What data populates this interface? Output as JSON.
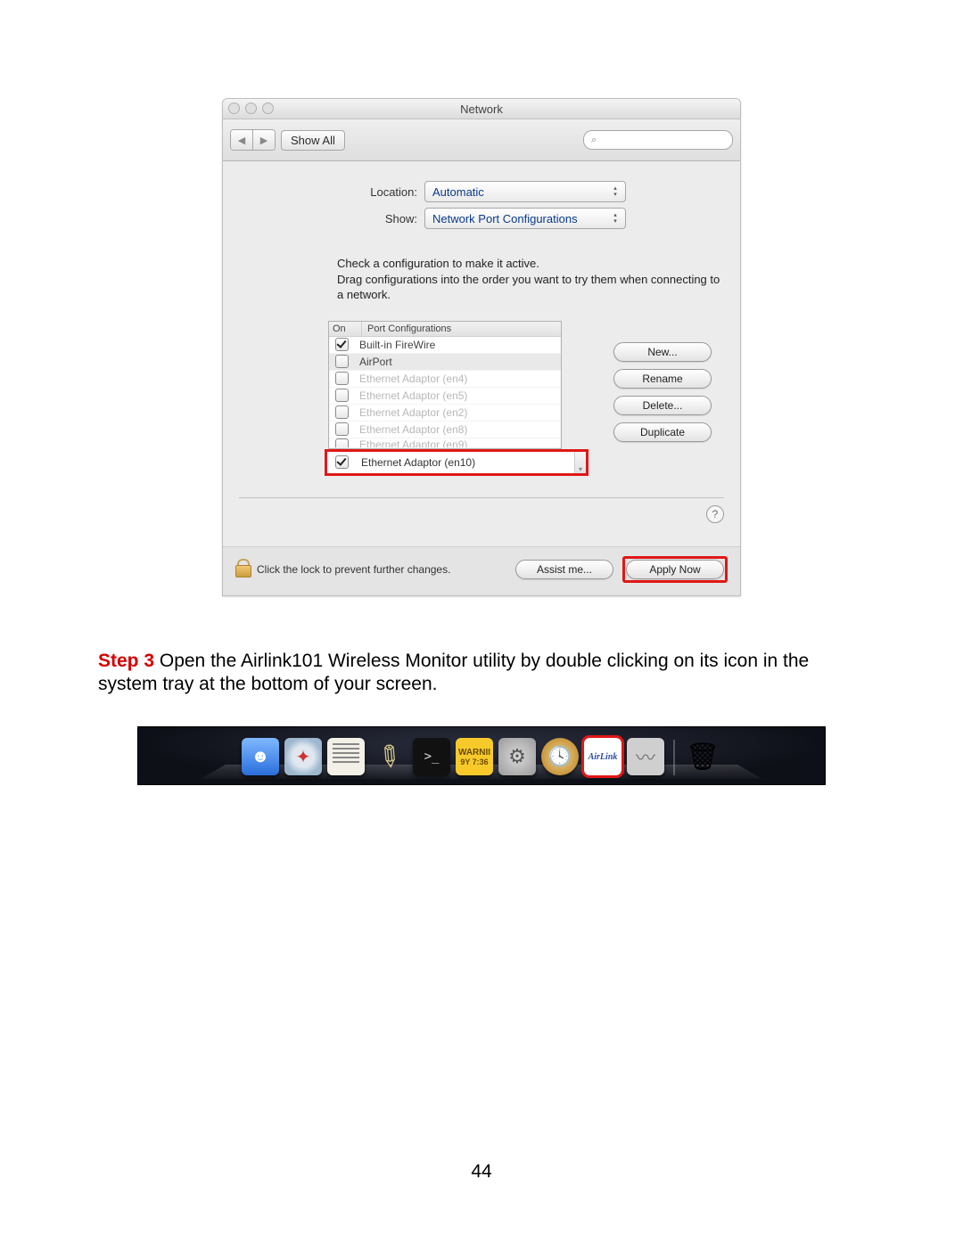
{
  "page_number": "44",
  "step": {
    "label": "Step 3",
    "text": " Open the Airlink101 Wireless Monitor utility by double clicking on its icon in the system tray at the bottom of your screen."
  },
  "network_window": {
    "title": "Network",
    "toolbar": {
      "show_all": "Show All",
      "search_placeholder": ""
    },
    "form": {
      "location_label": "Location:",
      "location_value": "Automatic",
      "show_label": "Show:",
      "show_value": "Network Port Configurations"
    },
    "instructions": "Check a configuration to make it active.\nDrag configurations into the order you want to try them when connecting to a network.",
    "port_header": {
      "on": "On",
      "name": "Port Configurations"
    },
    "ports": [
      {
        "checked": true,
        "name": "Built-in FireWire",
        "selected": false,
        "faded": false
      },
      {
        "checked": false,
        "name": "AirPort",
        "selected": true,
        "faded": false
      },
      {
        "checked": false,
        "name": "Ethernet Adaptor (en4)",
        "selected": false,
        "faded": true
      },
      {
        "checked": false,
        "name": "Ethernet Adaptor (en5)",
        "selected": false,
        "faded": true
      },
      {
        "checked": false,
        "name": "Ethernet Adaptor (en2)",
        "selected": false,
        "faded": true
      },
      {
        "checked": false,
        "name": "Ethernet Adaptor (en8)",
        "selected": false,
        "faded": true
      },
      {
        "checked": false,
        "name": "Ethernet Adaptor (en9)",
        "selected": false,
        "faded": true,
        "cutoff": true
      }
    ],
    "highlight_port": {
      "checked": true,
      "name": "Ethernet Adaptor (en10)"
    },
    "side_buttons": {
      "new": "New...",
      "rename": "Rename",
      "delete": "Delete...",
      "duplicate": "Duplicate"
    },
    "help": "?",
    "footer": {
      "lock_text": "Click the lock to prevent further changes.",
      "assist": "Assist me...",
      "apply": "Apply Now"
    }
  },
  "dock": {
    "warn_line1": "WARNII",
    "warn_line2": "9Y 7:36",
    "airlink_label": "AirLink"
  }
}
